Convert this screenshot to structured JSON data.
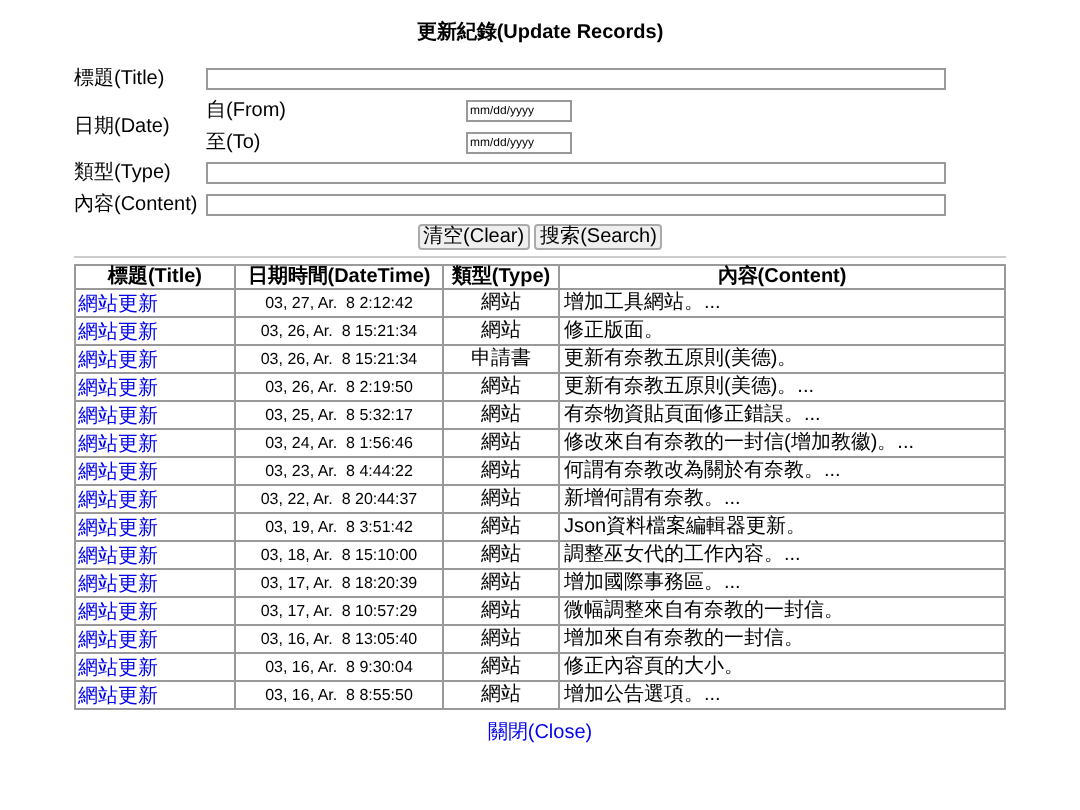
{
  "title": "更新紀錄(Update Records)",
  "form": {
    "title_label": "標題(Title)",
    "date_label": "日期(Date)",
    "from_label": "自(From)",
    "from_placeholder": "mm/dd/yyyy",
    "to_label": "至(To)",
    "to_placeholder": "mm/dd/yyyy",
    "type_label": "類型(Type)",
    "content_label": "內容(Content)"
  },
  "buttons": [
    "清空(Clear)",
    "搜索(Search)"
  ],
  "table": {
    "columns": [
      "標題(Title)",
      "日期時間(DateTime)",
      "類型(Type)",
      "內容(Content)"
    ],
    "rows": [
      {
        "title": "網站更新",
        "datetime": "03, 27, Ar.  8 2:12:42",
        "type": "網站",
        "content": "增加工具網站。..."
      },
      {
        "title": "網站更新",
        "datetime": "03, 26, Ar.  8 15:21:34",
        "type": "網站",
        "content": "修正版面。"
      },
      {
        "title": "網站更新",
        "datetime": "03, 26, Ar.  8 15:21:34",
        "type": "申請書",
        "content": "更新有奈教五原則(美德)。"
      },
      {
        "title": "網站更新",
        "datetime": "03, 26, Ar.  8 2:19:50",
        "type": "網站",
        "content": "更新有奈教五原則(美德)。..."
      },
      {
        "title": "網站更新",
        "datetime": "03, 25, Ar.  8 5:32:17",
        "type": "網站",
        "content": "有奈物資貼頁面修正錯誤。..."
      },
      {
        "title": "網站更新",
        "datetime": "03, 24, Ar.  8 1:56:46",
        "type": "網站",
        "content": "修改來自有奈教的一封信(增加教徽)。..."
      },
      {
        "title": "網站更新",
        "datetime": "03, 23, Ar.  8 4:44:22",
        "type": "網站",
        "content": "何謂有奈教改為關於有奈教。..."
      },
      {
        "title": "網站更新",
        "datetime": "03, 22, Ar.  8 20:44:37",
        "type": "網站",
        "content": "新增何謂有奈教。..."
      },
      {
        "title": "網站更新",
        "datetime": "03, 19, Ar.  8 3:51:42",
        "type": "網站",
        "content": "Json資料檔案編輯器更新。"
      },
      {
        "title": "網站更新",
        "datetime": "03, 18, Ar.  8 15:10:00",
        "type": "網站",
        "content": "調整巫女代的工作內容。..."
      },
      {
        "title": "網站更新",
        "datetime": "03, 17, Ar.  8 18:20:39",
        "type": "網站",
        "content": "增加國際事務區。..."
      },
      {
        "title": "網站更新",
        "datetime": "03, 17, Ar.  8 10:57:29",
        "type": "網站",
        "content": "微幅調整來自有奈教的一封信。"
      },
      {
        "title": "網站更新",
        "datetime": "03, 16, Ar.  8 13:05:40",
        "type": "網站",
        "content": "增加來自有奈教的一封信。"
      },
      {
        "title": "網站更新",
        "datetime": "03, 16, Ar.  8 9:30:04",
        "type": "網站",
        "content": "修正內容頁的大小。"
      },
      {
        "title": "網站更新",
        "datetime": "03, 16, Ar.  8 8:55:50",
        "type": "網站",
        "content": "增加公告選項。..."
      }
    ]
  },
  "close_link": "關閉(Close)"
}
